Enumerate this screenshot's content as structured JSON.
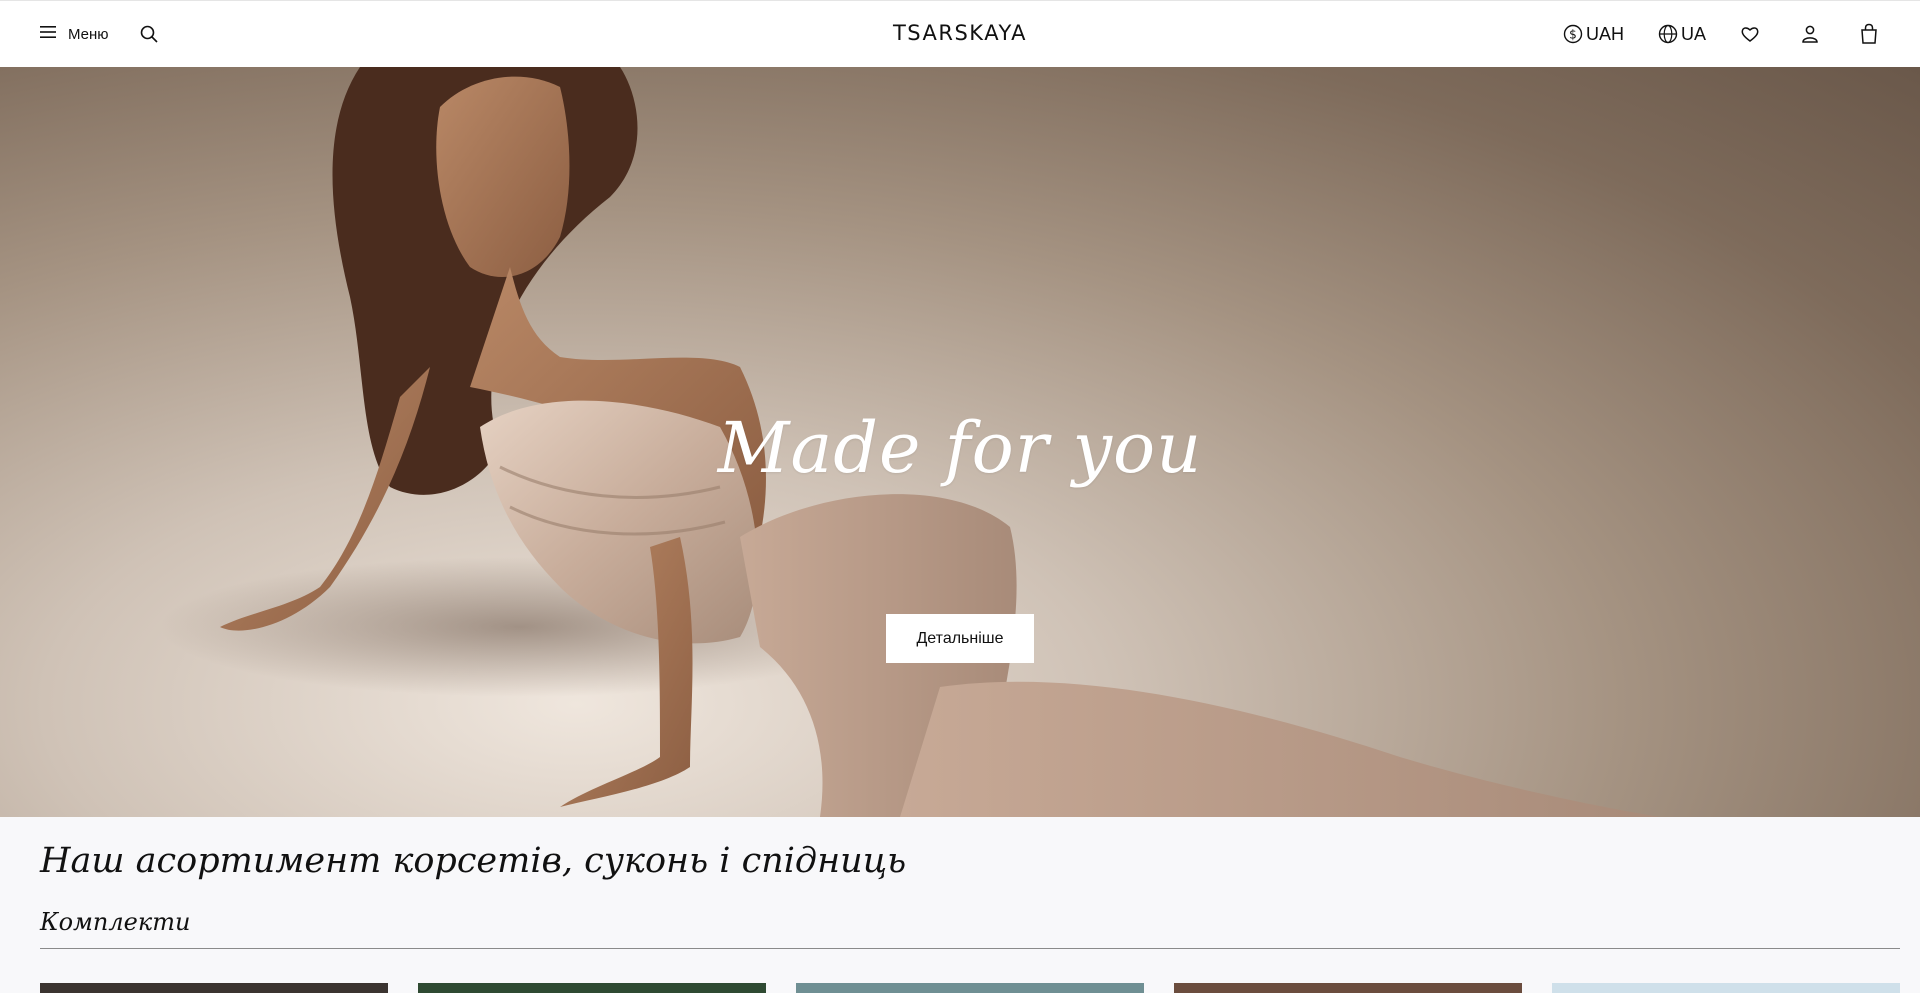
{
  "header": {
    "menu_label": "Меню",
    "logo": "TSARSKAYA",
    "currency": "UAH",
    "language": "UA",
    "icons": [
      "menu-icon",
      "search-icon",
      "currency-icon",
      "globe-icon",
      "heart-icon",
      "user-icon",
      "bag-icon"
    ]
  },
  "hero": {
    "title": "Made for you",
    "button_label": "Детальніше"
  },
  "section": {
    "title": "Наш асортимент корсетів, суконь і спідниць",
    "subtitle": "Комплекти"
  },
  "colors": {
    "text": "#111111",
    "header_bg": "#ffffff",
    "section_bg": "#f8f8fa",
    "hero_button_bg": "#ffffff"
  }
}
